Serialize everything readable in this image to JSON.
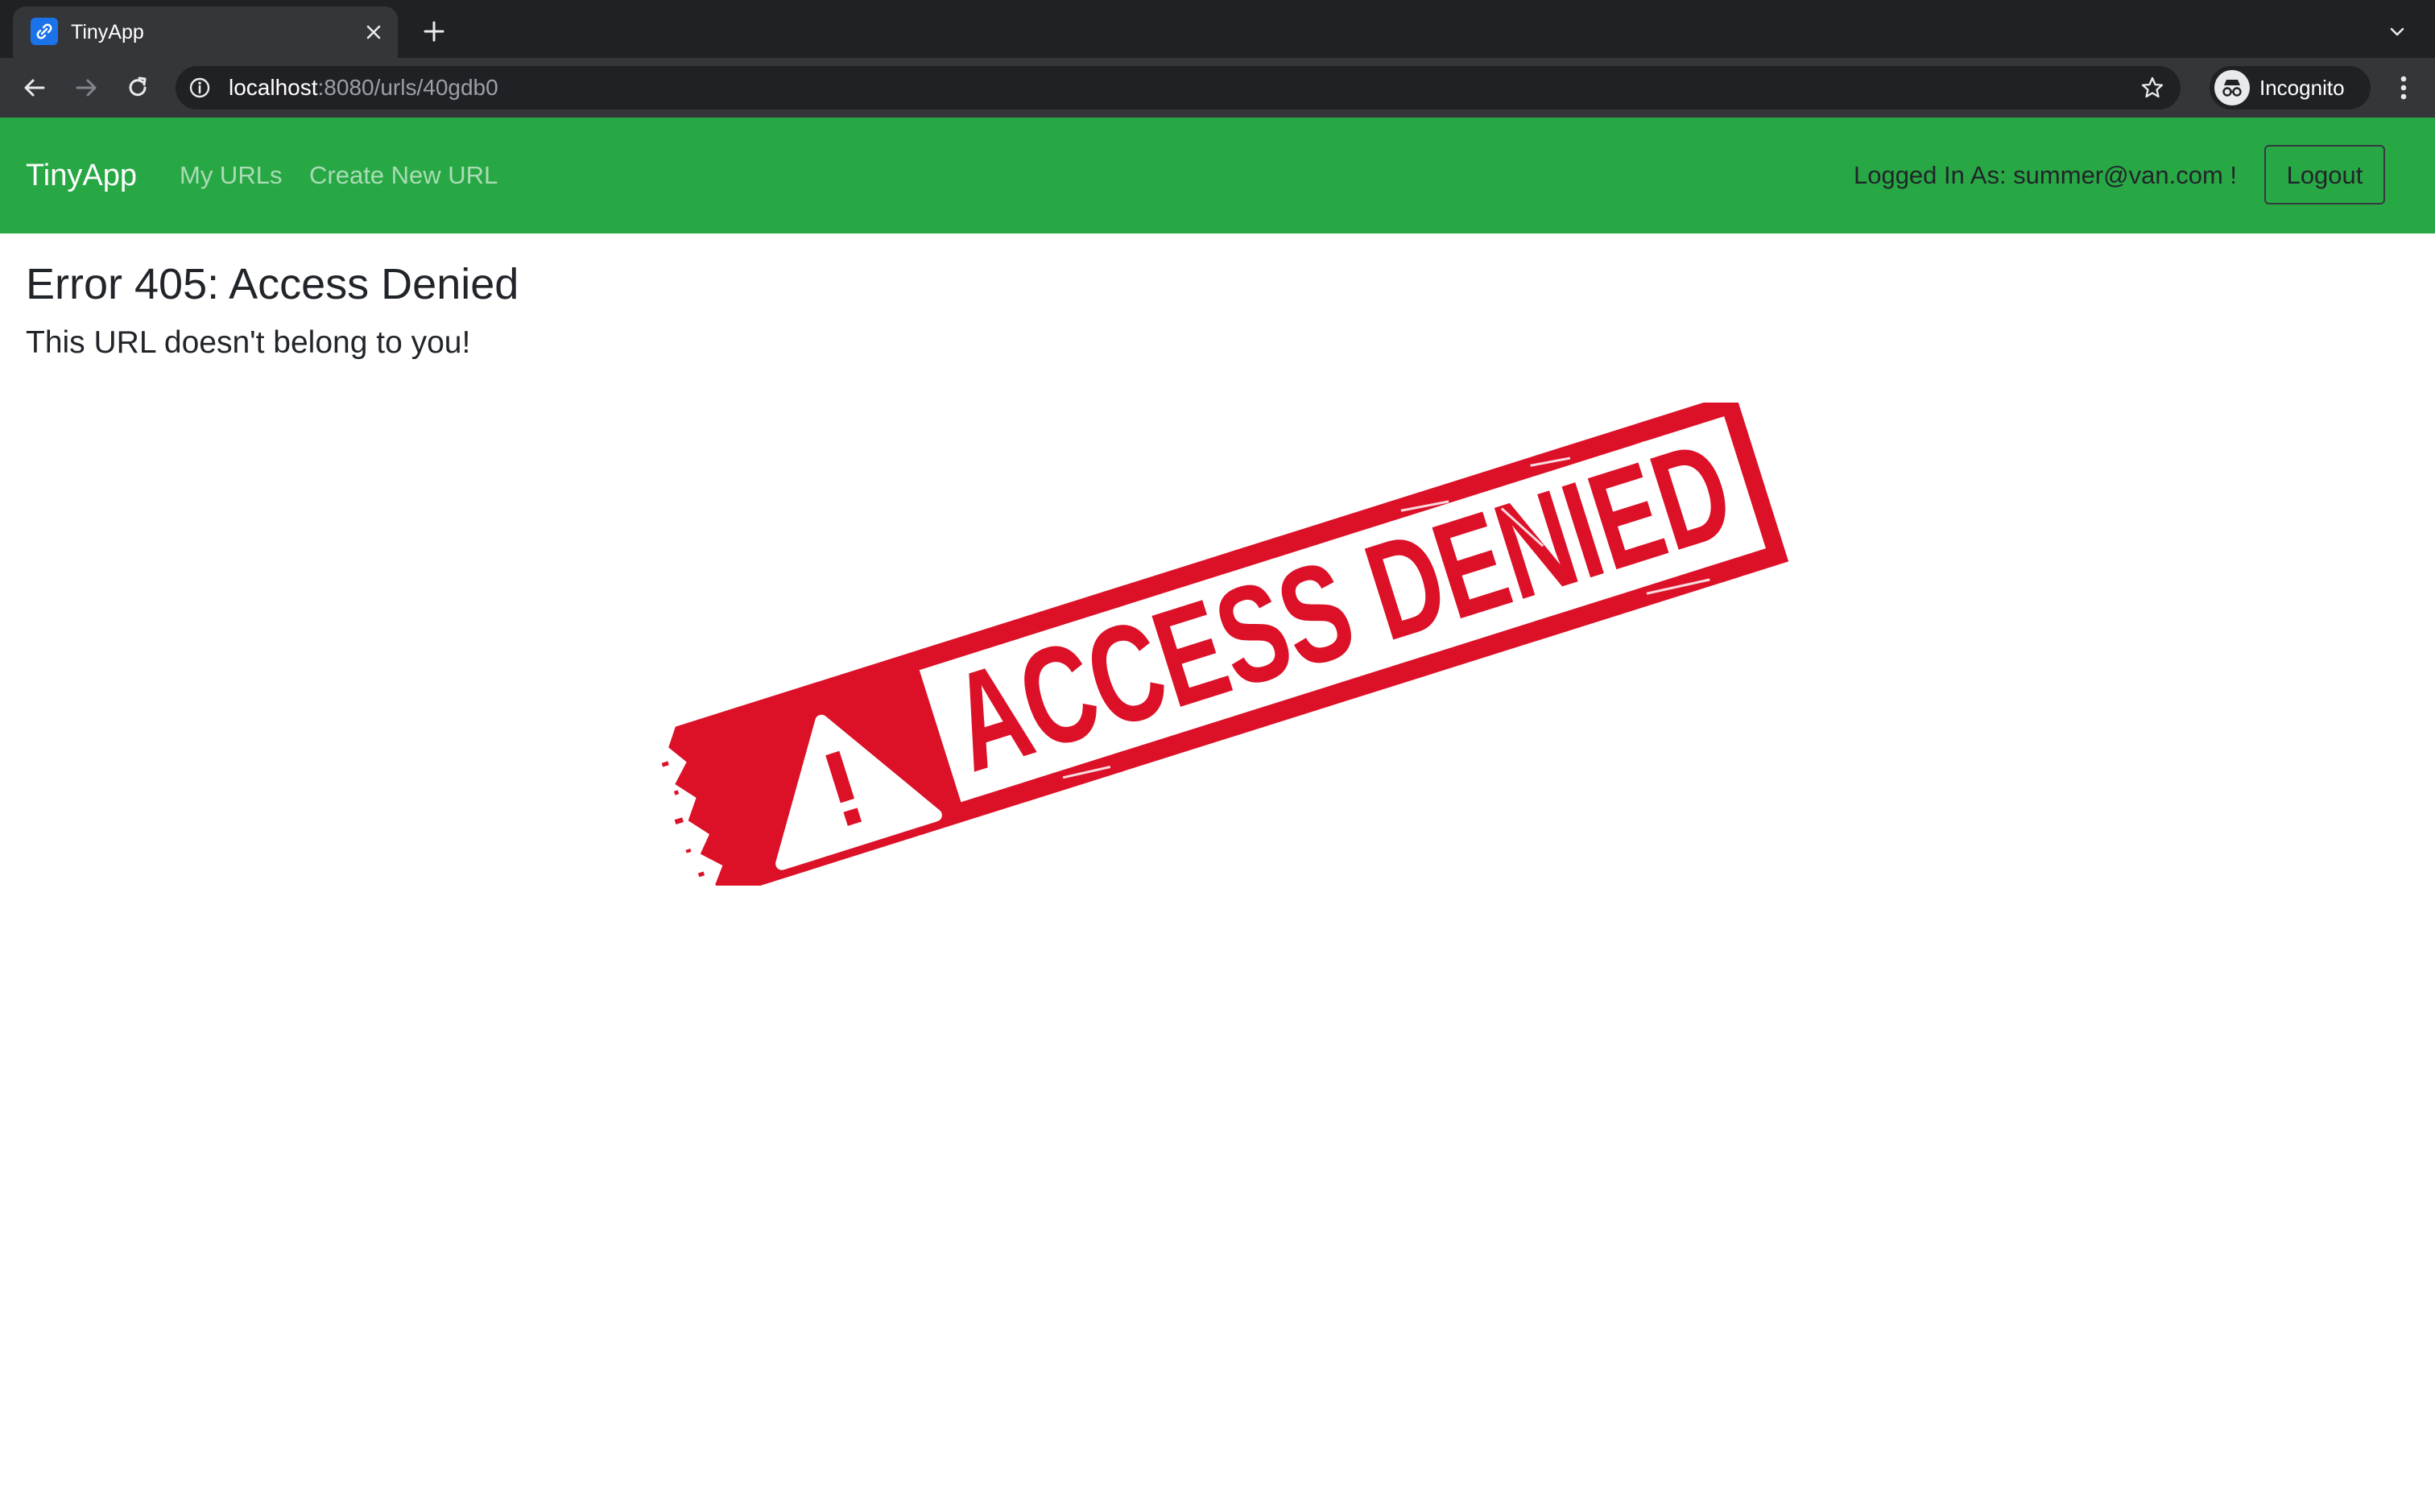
{
  "browser": {
    "tab_title": "TinyApp",
    "url_host": "localhost",
    "url_path": ":8080/urls/40gdb0",
    "profile_label": "Incognito",
    "icons": [
      "tinyapp-favicon-icon",
      "close-icon",
      "plus-icon",
      "chevron-down-icon",
      "back-icon",
      "forward-icon",
      "reload-icon",
      "info-icon",
      "star-icon",
      "incognito-icon",
      "more-vert-icon"
    ]
  },
  "navbar": {
    "brand": "TinyApp",
    "links": [
      "My URLs",
      "Create New URL"
    ],
    "logged_in_text": "Logged In As: summer@van.com !",
    "logout_label": "Logout"
  },
  "main": {
    "title": "Error 405: Access Denied",
    "subtitle": "This URL doesn't belong to you!",
    "stamp_text": "ACCESS DENIED"
  },
  "colors": {
    "navbar_bg": "#28a745",
    "stamp_red": "#dc1128",
    "chrome_dark": "#202124",
    "chrome_toolbar": "#35363a"
  }
}
